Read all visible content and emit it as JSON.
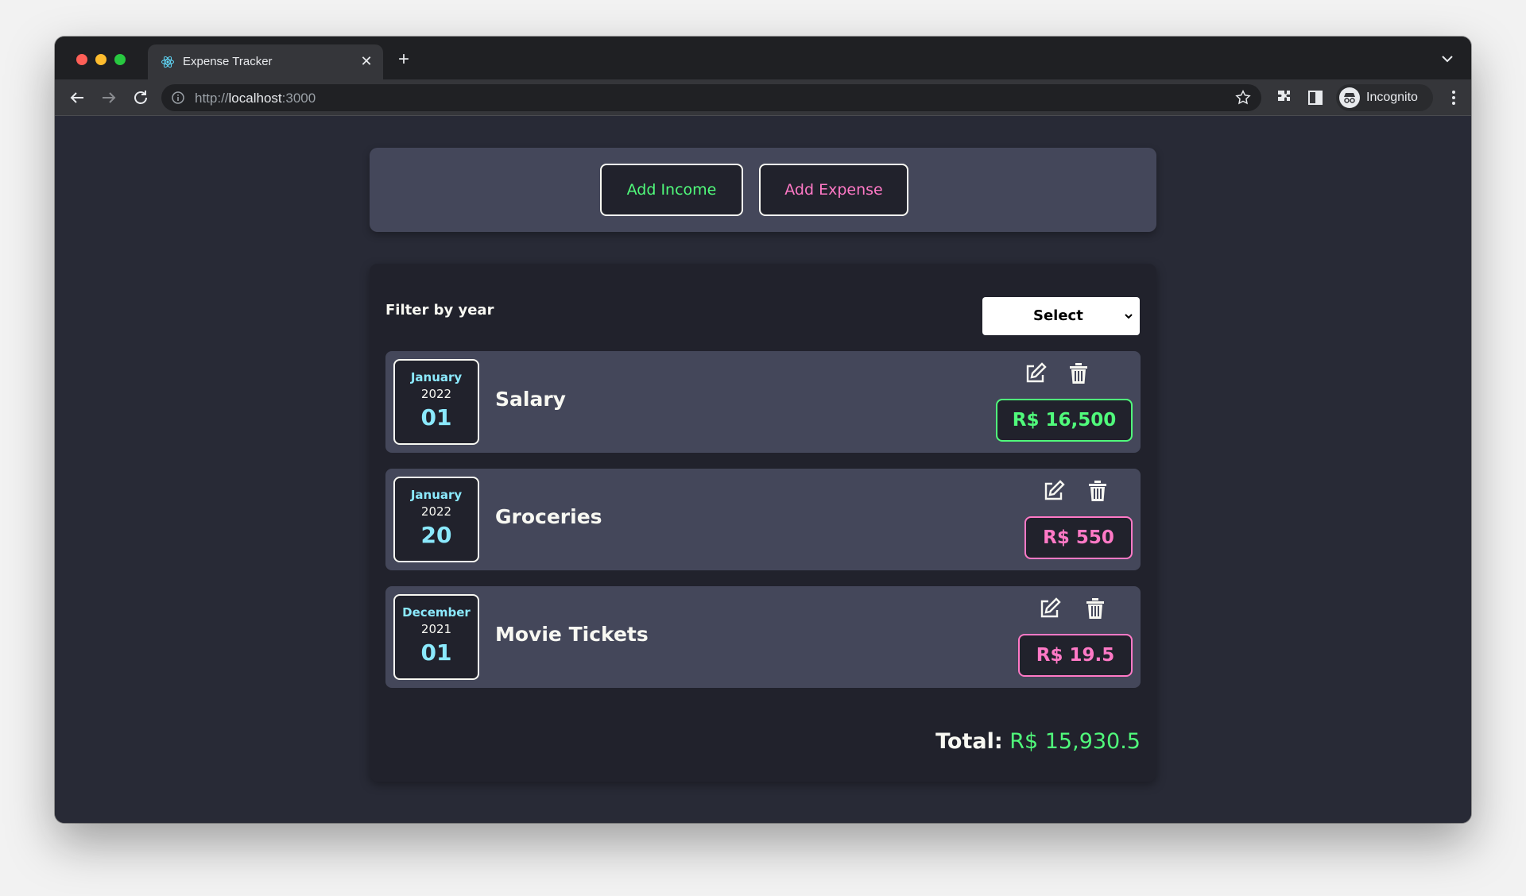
{
  "browser": {
    "tab_title": "Expense Tracker",
    "url_scheme": "http://",
    "url_host": "localhost",
    "url_port": ":3000",
    "profile_label": "Incognito"
  },
  "actions": {
    "add_income_label": "Add Income",
    "add_expense_label": "Add Expense"
  },
  "filter": {
    "label": "Filter by year",
    "select_value": "Select"
  },
  "expenses": [
    {
      "month": "January",
      "year": "2022",
      "day": "01",
      "title": "Salary",
      "amount": "R$ 16,500",
      "type": "income"
    },
    {
      "month": "January",
      "year": "2022",
      "day": "20",
      "title": "Groceries",
      "amount": "R$ 550",
      "type": "expense"
    },
    {
      "month": "December",
      "year": "2021",
      "day": "01",
      "title": "Movie Tickets",
      "amount": "R$ 19.5",
      "type": "expense"
    }
  ],
  "total": {
    "label": "Total:",
    "value": "R$ 15,930.5"
  },
  "colors": {
    "income": "#50fa7b",
    "expense": "#ff79c6",
    "date_accent": "#8be9fd",
    "card": "#44475a",
    "background": "#282a36"
  },
  "icons": {
    "edit": "edit-icon",
    "delete": "trash-icon"
  }
}
